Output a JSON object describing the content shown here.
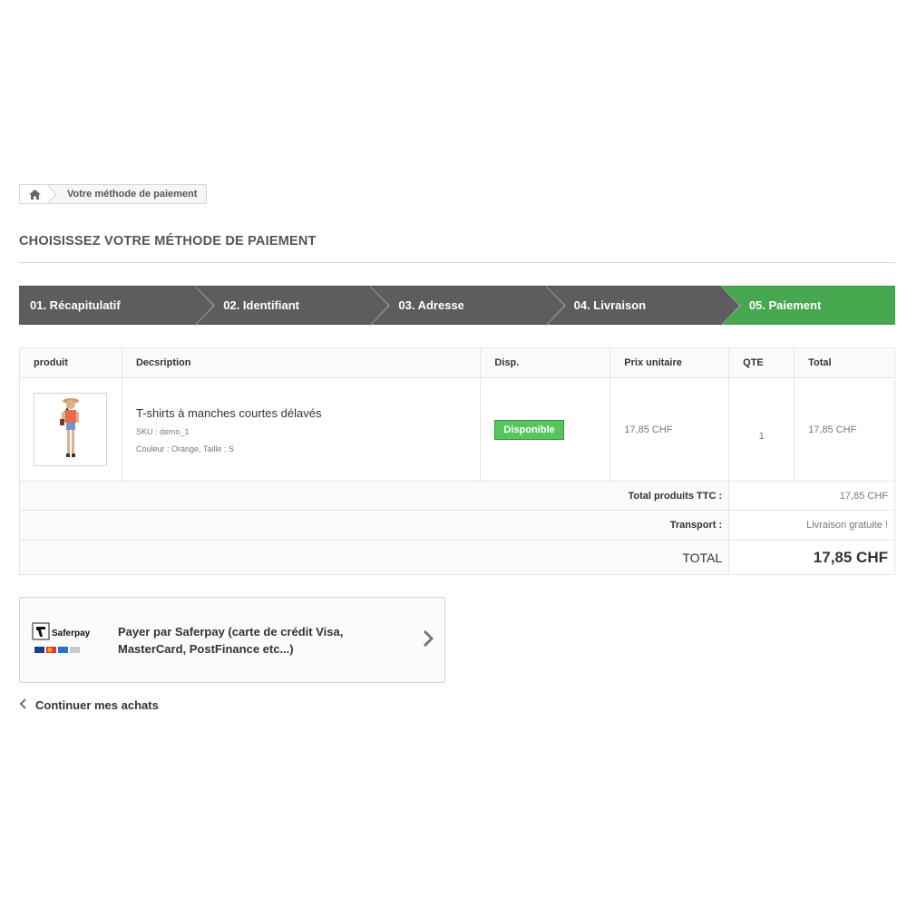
{
  "breadcrumb": {
    "current": "Votre méthode de paiement"
  },
  "page_heading": "CHOISISSEZ VOTRE MÉTHODE DE PAIEMENT",
  "steps": [
    {
      "label": "01. Récapitulatif"
    },
    {
      "label": "02. Identifiant"
    },
    {
      "label": "03. Adresse"
    },
    {
      "label": "04. Livraison"
    },
    {
      "label": "05. Paiement"
    }
  ],
  "colors": {
    "step": "#5d5d5d",
    "active_step": "#46a74e",
    "available": "#55c65e"
  },
  "table": {
    "headers": [
      "produit",
      "Decsription",
      "Disp.",
      "Prix unitaire",
      "QTE",
      "Total"
    ],
    "product": {
      "title": "T-shirts à manches courtes délavés",
      "sku": "SKU : demo_1",
      "attributes": "Couleur : Orange, Taille : S",
      "availability": "Disponible",
      "unit_price": "17,85 CHF",
      "qty": "1",
      "total": "17,85 CHF"
    },
    "summary": {
      "products_label": "Total produits TTC :",
      "products_value": "17,85 CHF",
      "shipping_label": "Transport :",
      "shipping_value": "Livraison gratuite !",
      "total_label": "TOTAL",
      "total_value": "17,85 CHF"
    }
  },
  "payment": {
    "logo_text": "Saferpay",
    "label": "Payer par Saferpay (carte de crédit Visa, MasterCard, PostFinance etc...)"
  },
  "continue_label": "Continuer mes achats"
}
